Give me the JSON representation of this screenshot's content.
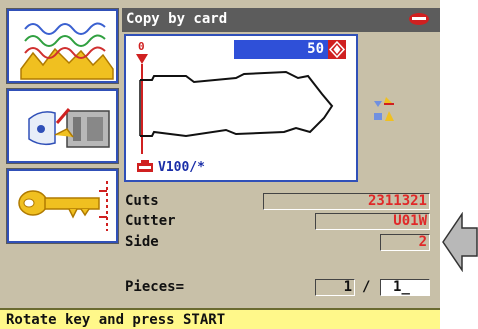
{
  "title": "Copy by card",
  "profile": {
    "step_value": "50",
    "code": "V100/*"
  },
  "fields": {
    "cuts": {
      "label": "Cuts",
      "value": "2311321"
    },
    "cutter": {
      "label": "Cutter",
      "value": "U01W"
    },
    "side": {
      "label": "Side",
      "value": "2"
    },
    "pieces": {
      "label": "Pieces=",
      "done": "1",
      "separator": "/",
      "total": "1"
    }
  },
  "status": "Rotate key and press START",
  "icons": {
    "side_buttons": [
      "key-cuts-icon",
      "card-reader-icon",
      "key-length-icon"
    ],
    "brand": "silca-logo-icon",
    "pointer": "left-arrow-icon"
  },
  "colors": {
    "background": "#c8c0a8",
    "titlebar": "#5c5c5c",
    "accent": "#2f50d8",
    "value_red": "#e02828",
    "status_bar": "#fff88a"
  }
}
